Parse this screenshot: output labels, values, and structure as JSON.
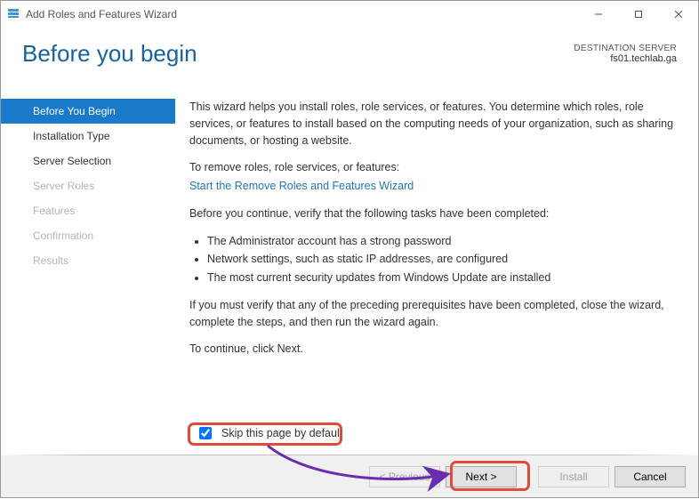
{
  "titlebar": {
    "title": "Add Roles and Features Wizard"
  },
  "header": {
    "page_title": "Before you begin",
    "dest_label": "DESTINATION SERVER",
    "dest_server": "fs01.techlab.ga"
  },
  "sidebar": {
    "items": [
      {
        "label": "Before You Begin"
      },
      {
        "label": "Installation Type"
      },
      {
        "label": "Server Selection"
      },
      {
        "label": "Server Roles"
      },
      {
        "label": "Features"
      },
      {
        "label": "Confirmation"
      },
      {
        "label": "Results"
      }
    ]
  },
  "content": {
    "intro": "This wizard helps you install roles, role services, or features. You determine which roles, role services, or features to install based on the computing needs of your organization, such as sharing documents, or hosting a website.",
    "remove_label": "To remove roles, role services, or features:",
    "remove_link": "Start the Remove Roles and Features Wizard",
    "verify_label": "Before you continue, verify that the following tasks have been completed:",
    "bullets": [
      "The Administrator account has a strong password",
      "Network settings, such as static IP addresses, are configured",
      "The most current security updates from Windows Update are installed"
    ],
    "verify_note": "If you must verify that any of the preceding prerequisites have been completed, close the wizard, complete the steps, and then run the wizard again.",
    "continue_note": "To continue, click Next."
  },
  "skip": {
    "label": "Skip this page by default",
    "checked": true
  },
  "footer": {
    "previous": "< Previous",
    "next": "Next >",
    "install": "Install",
    "cancel": "Cancel"
  }
}
